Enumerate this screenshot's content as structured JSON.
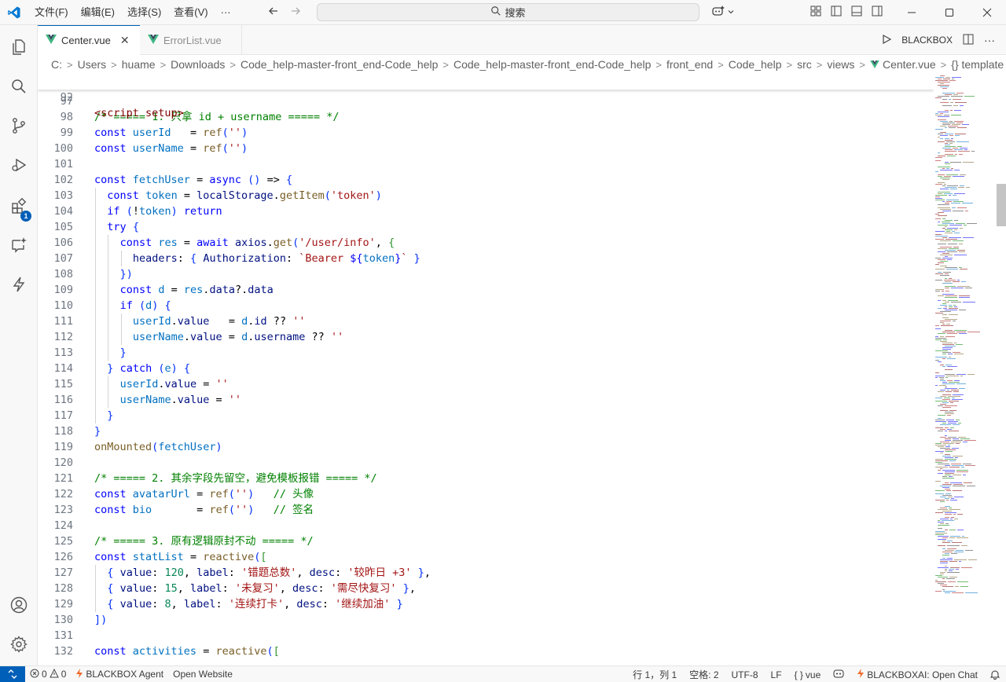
{
  "titlebar": {
    "menus": [
      "文件(F)",
      "编辑(E)",
      "选择(S)",
      "查看(V)",
      "···"
    ],
    "search_text": "搜索"
  },
  "tabs": [
    {
      "label": "Center.vue",
      "active": true
    },
    {
      "label": "ErrorList.vue",
      "active": false
    }
  ],
  "tabs_right": {
    "blackbox_label": "BLACKBOX"
  },
  "activity_badge": "1",
  "breadcrumb": [
    "C:",
    "Users",
    "huame",
    "Downloads",
    "Code_help-master-front_end-Code_help",
    "Code_help-master-front_end-Code_help",
    "front_end",
    "Code_help",
    "src",
    "views",
    "Center.vue",
    "{} template"
  ],
  "editor": {
    "sticky_line": {
      "number": "92",
      "text": "<script setup>"
    },
    "lines": [
      {
        "n": "97",
        "t": ""
      },
      {
        "n": "98",
        "t": "/* ===== 1. 只拿 id + username ===== */"
      },
      {
        "n": "99",
        "t": "const userId   = ref('')"
      },
      {
        "n": "100",
        "t": "const userName = ref('')"
      },
      {
        "n": "101",
        "t": ""
      },
      {
        "n": "102",
        "t": "const fetchUser = async () => {"
      },
      {
        "n": "103",
        "t": "  const token = localStorage.getItem('token')"
      },
      {
        "n": "104",
        "t": "  if (!token) return"
      },
      {
        "n": "105",
        "t": "  try {"
      },
      {
        "n": "106",
        "t": "    const res = await axios.get('/user/info', {"
      },
      {
        "n": "107",
        "t": "      headers: { Authorization: `Bearer ${token}` }"
      },
      {
        "n": "108",
        "t": "    })"
      },
      {
        "n": "109",
        "t": "    const d = res.data?.data"
      },
      {
        "n": "110",
        "t": "    if (d) {"
      },
      {
        "n": "111",
        "t": "      userId.value   = d.id ?? ''"
      },
      {
        "n": "112",
        "t": "      userName.value = d.username ?? ''"
      },
      {
        "n": "113",
        "t": "    }"
      },
      {
        "n": "114",
        "t": "  } catch (e) {"
      },
      {
        "n": "115",
        "t": "    userId.value = ''"
      },
      {
        "n": "116",
        "t": "    userName.value = ''"
      },
      {
        "n": "117",
        "t": "  }"
      },
      {
        "n": "118",
        "t": "}"
      },
      {
        "n": "119",
        "t": "onMounted(fetchUser)"
      },
      {
        "n": "120",
        "t": ""
      },
      {
        "n": "121",
        "t": "/* ===== 2. 其余字段先留空，避免模板报错 ===== */"
      },
      {
        "n": "122",
        "t": "const avatarUrl = ref('')   // 头像"
      },
      {
        "n": "123",
        "t": "const bio       = ref('')   // 签名"
      },
      {
        "n": "124",
        "t": ""
      },
      {
        "n": "125",
        "t": "/* ===== 3. 原有逻辑原封不动 ===== */"
      },
      {
        "n": "126",
        "t": "const statList = reactive(["
      },
      {
        "n": "127",
        "t": "  { value: 120, label: '错题总数', desc: '较昨日 +3' },"
      },
      {
        "n": "128",
        "t": "  { value: 15, label: '未复习', desc: '需尽快复习' },"
      },
      {
        "n": "129",
        "t": "  { value: 8, label: '连续打卡', desc: '继续加油' }"
      },
      {
        "n": "130",
        "t": "])"
      },
      {
        "n": "131",
        "t": ""
      },
      {
        "n": "132",
        "t": "const activities = reactive(["
      }
    ]
  },
  "statusbar": {
    "errors": "0",
    "warnings": "0",
    "blackbox_agent": "BLACKBOX Agent",
    "open_website": "Open Website",
    "position": "行 1，列 1",
    "spaces": "空格: 2",
    "encoding": "UTF-8",
    "eol": "LF",
    "language": "vue",
    "blackbox_chat": "BLACKBOXAI: Open Chat"
  },
  "colors": {
    "accent": "#005fb8",
    "keyword": "#0000ff",
    "comment": "#008000",
    "string": "#a31515",
    "number": "#098658",
    "variable": "#0070c1",
    "function": "#795e26",
    "vue_green": "#41b883"
  },
  "icons": [
    "vscode-logo-icon",
    "arrow-left-icon",
    "arrow-right-icon",
    "search-icon",
    "copilot-icon",
    "layout-icon",
    "sidebar-left-icon",
    "panel-icon",
    "sidebar-right-icon",
    "minimize-icon",
    "maximize-icon",
    "close-icon",
    "explorer-icon",
    "search-icon",
    "source-control-icon",
    "run-debug-icon",
    "extensions-icon",
    "chat-icon",
    "bolt-icon",
    "account-icon",
    "settings-gear-icon",
    "vue-icon",
    "run-icon",
    "split-editor-icon",
    "more-icon",
    "remote-icon",
    "error-icon",
    "warning-icon",
    "bell-icon"
  ]
}
